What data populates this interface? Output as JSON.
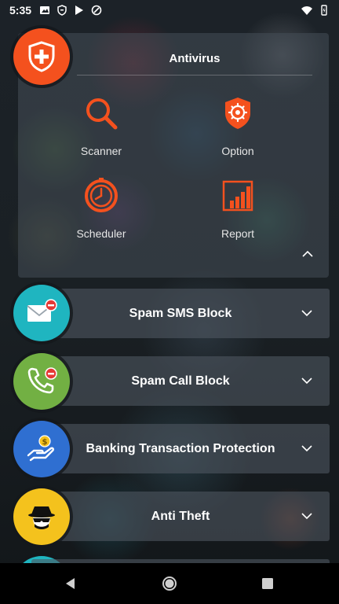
{
  "status_bar": {
    "time": "5:35"
  },
  "antivirus": {
    "title": "Antivirus",
    "tiles": [
      {
        "label": "Scanner",
        "icon": "search-icon"
      },
      {
        "label": "Option",
        "icon": "settings-icon"
      },
      {
        "label": "Scheduler",
        "icon": "clock-icon"
      },
      {
        "label": "Report",
        "icon": "report-icon"
      }
    ]
  },
  "features": [
    {
      "label": "Spam SMS Block",
      "icon": "mail-block-icon",
      "color": "#1fb5c0"
    },
    {
      "label": "Spam Call Block",
      "icon": "phone-block-icon",
      "color": "#72b043"
    },
    {
      "label": "Banking Transaction Protection",
      "icon": "hand-coin-icon",
      "color": "#2f6fd1"
    },
    {
      "label": "Anti Theft",
      "icon": "spy-icon",
      "color": "#f4c21d"
    }
  ],
  "colors": {
    "accent": "#f4511e"
  }
}
